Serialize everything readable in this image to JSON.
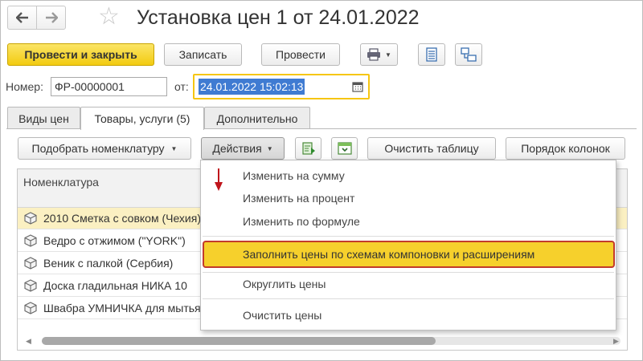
{
  "header": {
    "title": "Установка цен 1 от 24.01.2022",
    "back_icon": "arrow-left-icon",
    "forward_icon": "arrow-right-icon",
    "favorite_icon": "star-icon"
  },
  "toolbar": {
    "post_close_label": "Провести и закрыть",
    "save_label": "Записать",
    "post_label": "Провести",
    "print_icon": "printer-icon",
    "report_icon": "report-icon",
    "structure_icon": "structure-icon"
  },
  "fields": {
    "number_label": "Номер:",
    "number_value": "ФР-00000001",
    "date_label": "от:",
    "date_value": "24.01.2022 15:02:13",
    "calendar_icon": "calendar-icon"
  },
  "tabs": [
    {
      "label": "Виды цен",
      "active": false
    },
    {
      "label": "Товары, услуги (5)",
      "active": true
    },
    {
      "label": "Дополнительно",
      "active": false
    }
  ],
  "table_toolbar": {
    "pick_label": "Подобрать номенклатуру",
    "actions_label": "Действия",
    "clear_label": "Очистить таблицу",
    "column_order_label": "Порядок колонок"
  },
  "table": {
    "column": "Номенклатура",
    "rows": [
      "2010 Сметка с совком (Чехия)",
      "Ведро с отжимом (\"YORK\")",
      "Веник с палкой (Сербия)",
      "Доска гладильная  НИКА 10",
      "Швабра УМНИЧКА для мытья окон"
    ],
    "selected_row": 0
  },
  "menu": {
    "items": [
      "Изменить на сумму",
      "Изменить на процент",
      "Изменить по формуле",
      "Заполнить цены по схемам компоновки и расширениям",
      "Округлить цены",
      "Очистить цены"
    ],
    "highlighted": 3
  },
  "colors": {
    "primary_button": "#f2cb10",
    "highlight_border": "#c23b2c",
    "date_focus": "#f6c611",
    "selection": "#3f7bd2",
    "arrow": "#c0141b"
  }
}
